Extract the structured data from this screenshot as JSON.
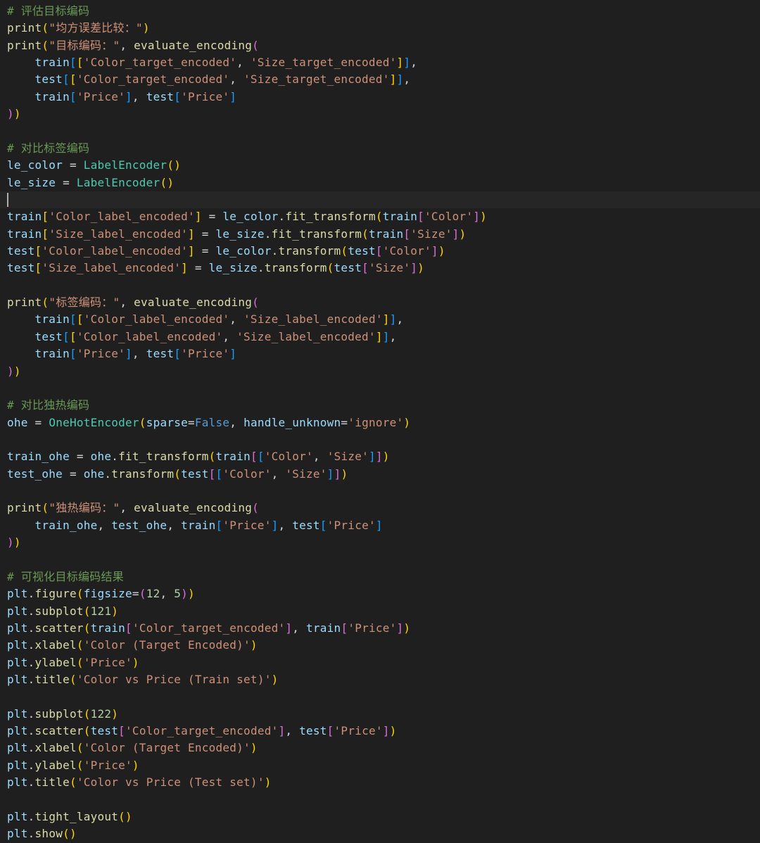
{
  "editor": {
    "lines": [
      [
        [
          "# 评估目标编码",
          "#6a9955"
        ]
      ],
      [
        [
          "print",
          "#dcdcaa"
        ],
        [
          "(",
          "#ffd700"
        ],
        [
          "\"均方误差比较：\"",
          "#ce9178"
        ],
        [
          ")",
          "#ffd700"
        ]
      ],
      [
        [
          "print",
          "#dcdcaa"
        ],
        [
          "(",
          "#ffd700"
        ],
        [
          "\"目标编码：\"",
          "#ce9178"
        ],
        [
          ", ",
          "#d4d4d4"
        ],
        [
          "evaluate_encoding",
          "#dcdcaa"
        ],
        [
          "(",
          "#da70d6"
        ]
      ],
      [
        [
          "    ",
          "#d4d4d4"
        ],
        [
          "train",
          "#9cdcfe"
        ],
        [
          "[",
          "#179fff"
        ],
        [
          "[",
          "#ffd700"
        ],
        [
          "'Color_target_encoded'",
          "#ce9178"
        ],
        [
          ", ",
          "#d4d4d4"
        ],
        [
          "'Size_target_encoded'",
          "#ce9178"
        ],
        [
          "]",
          "#ffd700"
        ],
        [
          "]",
          "#179fff"
        ],
        [
          ",",
          "#d4d4d4"
        ]
      ],
      [
        [
          "    ",
          "#d4d4d4"
        ],
        [
          "test",
          "#9cdcfe"
        ],
        [
          "[",
          "#179fff"
        ],
        [
          "[",
          "#ffd700"
        ],
        [
          "'Color_target_encoded'",
          "#ce9178"
        ],
        [
          ", ",
          "#d4d4d4"
        ],
        [
          "'Size_target_encoded'",
          "#ce9178"
        ],
        [
          "]",
          "#ffd700"
        ],
        [
          "]",
          "#179fff"
        ],
        [
          ",",
          "#d4d4d4"
        ]
      ],
      [
        [
          "    ",
          "#d4d4d4"
        ],
        [
          "train",
          "#9cdcfe"
        ],
        [
          "[",
          "#179fff"
        ],
        [
          "'Price'",
          "#ce9178"
        ],
        [
          "]",
          "#179fff"
        ],
        [
          ", ",
          "#d4d4d4"
        ],
        [
          "test",
          "#9cdcfe"
        ],
        [
          "[",
          "#179fff"
        ],
        [
          "'Price'",
          "#ce9178"
        ],
        [
          "]",
          "#179fff"
        ]
      ],
      [
        [
          ")",
          "#da70d6"
        ],
        [
          ")",
          "#ffd700"
        ]
      ],
      [],
      [
        [
          "# 对比标签编码",
          "#6a9955"
        ]
      ],
      [
        [
          "le_color",
          "#9cdcfe"
        ],
        [
          " = ",
          "#d4d4d4"
        ],
        [
          "LabelEncoder",
          "#4ec9b0"
        ],
        [
          "(",
          "#ffd700"
        ],
        [
          ")",
          "#ffd700"
        ]
      ],
      [
        [
          "le_size",
          "#9cdcfe"
        ],
        [
          " = ",
          "#d4d4d4"
        ],
        [
          "LabelEncoder",
          "#4ec9b0"
        ],
        [
          "(",
          "#ffd700"
        ],
        [
          ")",
          "#ffd700"
        ]
      ],
      [],
      [
        [
          "train",
          "#9cdcfe"
        ],
        [
          "[",
          "#ffd700"
        ],
        [
          "'Color_label_encoded'",
          "#ce9178"
        ],
        [
          "]",
          "#ffd700"
        ],
        [
          " = ",
          "#d4d4d4"
        ],
        [
          "le_color",
          "#9cdcfe"
        ],
        [
          ".",
          "#d4d4d4"
        ],
        [
          "fit_transform",
          "#dcdcaa"
        ],
        [
          "(",
          "#ffd700"
        ],
        [
          "train",
          "#9cdcfe"
        ],
        [
          "[",
          "#da70d6"
        ],
        [
          "'Color'",
          "#ce9178"
        ],
        [
          "]",
          "#da70d6"
        ],
        [
          ")",
          "#ffd700"
        ]
      ],
      [
        [
          "train",
          "#9cdcfe"
        ],
        [
          "[",
          "#ffd700"
        ],
        [
          "'Size_label_encoded'",
          "#ce9178"
        ],
        [
          "]",
          "#ffd700"
        ],
        [
          " = ",
          "#d4d4d4"
        ],
        [
          "le_size",
          "#9cdcfe"
        ],
        [
          ".",
          "#d4d4d4"
        ],
        [
          "fit_transform",
          "#dcdcaa"
        ],
        [
          "(",
          "#ffd700"
        ],
        [
          "train",
          "#9cdcfe"
        ],
        [
          "[",
          "#da70d6"
        ],
        [
          "'Size'",
          "#ce9178"
        ],
        [
          "]",
          "#da70d6"
        ],
        [
          ")",
          "#ffd700"
        ]
      ],
      [
        [
          "test",
          "#9cdcfe"
        ],
        [
          "[",
          "#ffd700"
        ],
        [
          "'Color_label_encoded'",
          "#ce9178"
        ],
        [
          "]",
          "#ffd700"
        ],
        [
          " = ",
          "#d4d4d4"
        ],
        [
          "le_color",
          "#9cdcfe"
        ],
        [
          ".",
          "#d4d4d4"
        ],
        [
          "transform",
          "#dcdcaa"
        ],
        [
          "(",
          "#ffd700"
        ],
        [
          "test",
          "#9cdcfe"
        ],
        [
          "[",
          "#da70d6"
        ],
        [
          "'Color'",
          "#ce9178"
        ],
        [
          "]",
          "#da70d6"
        ],
        [
          ")",
          "#ffd700"
        ]
      ],
      [
        [
          "test",
          "#9cdcfe"
        ],
        [
          "[",
          "#ffd700"
        ],
        [
          "'Size_label_encoded'",
          "#ce9178"
        ],
        [
          "]",
          "#ffd700"
        ],
        [
          " = ",
          "#d4d4d4"
        ],
        [
          "le_size",
          "#9cdcfe"
        ],
        [
          ".",
          "#d4d4d4"
        ],
        [
          "transform",
          "#dcdcaa"
        ],
        [
          "(",
          "#ffd700"
        ],
        [
          "test",
          "#9cdcfe"
        ],
        [
          "[",
          "#da70d6"
        ],
        [
          "'Size'",
          "#ce9178"
        ],
        [
          "]",
          "#da70d6"
        ],
        [
          ")",
          "#ffd700"
        ]
      ],
      [],
      [
        [
          "print",
          "#dcdcaa"
        ],
        [
          "(",
          "#ffd700"
        ],
        [
          "\"标签编码：\"",
          "#ce9178"
        ],
        [
          ", ",
          "#d4d4d4"
        ],
        [
          "evaluate_encoding",
          "#dcdcaa"
        ],
        [
          "(",
          "#da70d6"
        ]
      ],
      [
        [
          "    ",
          "#d4d4d4"
        ],
        [
          "train",
          "#9cdcfe"
        ],
        [
          "[",
          "#179fff"
        ],
        [
          "[",
          "#ffd700"
        ],
        [
          "'Color_label_encoded'",
          "#ce9178"
        ],
        [
          ", ",
          "#d4d4d4"
        ],
        [
          "'Size_label_encoded'",
          "#ce9178"
        ],
        [
          "]",
          "#ffd700"
        ],
        [
          "]",
          "#179fff"
        ],
        [
          ",",
          "#d4d4d4"
        ]
      ],
      [
        [
          "    ",
          "#d4d4d4"
        ],
        [
          "test",
          "#9cdcfe"
        ],
        [
          "[",
          "#179fff"
        ],
        [
          "[",
          "#ffd700"
        ],
        [
          "'Color_label_encoded'",
          "#ce9178"
        ],
        [
          ", ",
          "#d4d4d4"
        ],
        [
          "'Size_label_encoded'",
          "#ce9178"
        ],
        [
          "]",
          "#ffd700"
        ],
        [
          "]",
          "#179fff"
        ],
        [
          ",",
          "#d4d4d4"
        ]
      ],
      [
        [
          "    ",
          "#d4d4d4"
        ],
        [
          "train",
          "#9cdcfe"
        ],
        [
          "[",
          "#179fff"
        ],
        [
          "'Price'",
          "#ce9178"
        ],
        [
          "]",
          "#179fff"
        ],
        [
          ", ",
          "#d4d4d4"
        ],
        [
          "test",
          "#9cdcfe"
        ],
        [
          "[",
          "#179fff"
        ],
        [
          "'Price'",
          "#ce9178"
        ],
        [
          "]",
          "#179fff"
        ]
      ],
      [
        [
          ")",
          "#da70d6"
        ],
        [
          ")",
          "#ffd700"
        ]
      ],
      [],
      [
        [
          "# 对比独热编码",
          "#6a9955"
        ]
      ],
      [
        [
          "ohe",
          "#9cdcfe"
        ],
        [
          " = ",
          "#d4d4d4"
        ],
        [
          "OneHotEncoder",
          "#4ec9b0"
        ],
        [
          "(",
          "#ffd700"
        ],
        [
          "sparse",
          "#9cdcfe"
        ],
        [
          "=",
          "#d4d4d4"
        ],
        [
          "False",
          "#569cd6"
        ],
        [
          ", ",
          "#d4d4d4"
        ],
        [
          "handle_unknown",
          "#9cdcfe"
        ],
        [
          "=",
          "#d4d4d4"
        ],
        [
          "'ignore'",
          "#ce9178"
        ],
        [
          ")",
          "#ffd700"
        ]
      ],
      [],
      [
        [
          "train_ohe",
          "#9cdcfe"
        ],
        [
          " = ",
          "#d4d4d4"
        ],
        [
          "ohe",
          "#9cdcfe"
        ],
        [
          ".",
          "#d4d4d4"
        ],
        [
          "fit_transform",
          "#dcdcaa"
        ],
        [
          "(",
          "#ffd700"
        ],
        [
          "train",
          "#9cdcfe"
        ],
        [
          "[",
          "#da70d6"
        ],
        [
          "[",
          "#179fff"
        ],
        [
          "'Color'",
          "#ce9178"
        ],
        [
          ", ",
          "#d4d4d4"
        ],
        [
          "'Size'",
          "#ce9178"
        ],
        [
          "]",
          "#179fff"
        ],
        [
          "]",
          "#da70d6"
        ],
        [
          ")",
          "#ffd700"
        ]
      ],
      [
        [
          "test_ohe",
          "#9cdcfe"
        ],
        [
          " = ",
          "#d4d4d4"
        ],
        [
          "ohe",
          "#9cdcfe"
        ],
        [
          ".",
          "#d4d4d4"
        ],
        [
          "transform",
          "#dcdcaa"
        ],
        [
          "(",
          "#ffd700"
        ],
        [
          "test",
          "#9cdcfe"
        ],
        [
          "[",
          "#da70d6"
        ],
        [
          "[",
          "#179fff"
        ],
        [
          "'Color'",
          "#ce9178"
        ],
        [
          ", ",
          "#d4d4d4"
        ],
        [
          "'Size'",
          "#ce9178"
        ],
        [
          "]",
          "#179fff"
        ],
        [
          "]",
          "#da70d6"
        ],
        [
          ")",
          "#ffd700"
        ]
      ],
      [],
      [
        [
          "print",
          "#dcdcaa"
        ],
        [
          "(",
          "#ffd700"
        ],
        [
          "\"独热编码：\"",
          "#ce9178"
        ],
        [
          ", ",
          "#d4d4d4"
        ],
        [
          "evaluate_encoding",
          "#dcdcaa"
        ],
        [
          "(",
          "#da70d6"
        ]
      ],
      [
        [
          "    ",
          "#d4d4d4"
        ],
        [
          "train_ohe",
          "#9cdcfe"
        ],
        [
          ", ",
          "#d4d4d4"
        ],
        [
          "test_ohe",
          "#9cdcfe"
        ],
        [
          ", ",
          "#d4d4d4"
        ],
        [
          "train",
          "#9cdcfe"
        ],
        [
          "[",
          "#179fff"
        ],
        [
          "'Price'",
          "#ce9178"
        ],
        [
          "]",
          "#179fff"
        ],
        [
          ", ",
          "#d4d4d4"
        ],
        [
          "test",
          "#9cdcfe"
        ],
        [
          "[",
          "#179fff"
        ],
        [
          "'Price'",
          "#ce9178"
        ],
        [
          "]",
          "#179fff"
        ]
      ],
      [
        [
          ")",
          "#da70d6"
        ],
        [
          ")",
          "#ffd700"
        ]
      ],
      [],
      [
        [
          "# 可视化目标编码结果",
          "#6a9955"
        ]
      ],
      [
        [
          "plt",
          "#9cdcfe"
        ],
        [
          ".",
          "#d4d4d4"
        ],
        [
          "figure",
          "#dcdcaa"
        ],
        [
          "(",
          "#ffd700"
        ],
        [
          "figsize",
          "#9cdcfe"
        ],
        [
          "=",
          "#d4d4d4"
        ],
        [
          "(",
          "#da70d6"
        ],
        [
          "12",
          "#b5cea8"
        ],
        [
          ", ",
          "#d4d4d4"
        ],
        [
          "5",
          "#b5cea8"
        ],
        [
          ")",
          "#da70d6"
        ],
        [
          ")",
          "#ffd700"
        ]
      ],
      [
        [
          "plt",
          "#9cdcfe"
        ],
        [
          ".",
          "#d4d4d4"
        ],
        [
          "subplot",
          "#dcdcaa"
        ],
        [
          "(",
          "#ffd700"
        ],
        [
          "121",
          "#b5cea8"
        ],
        [
          ")",
          "#ffd700"
        ]
      ],
      [
        [
          "plt",
          "#9cdcfe"
        ],
        [
          ".",
          "#d4d4d4"
        ],
        [
          "scatter",
          "#dcdcaa"
        ],
        [
          "(",
          "#ffd700"
        ],
        [
          "train",
          "#9cdcfe"
        ],
        [
          "[",
          "#da70d6"
        ],
        [
          "'Color_target_encoded'",
          "#ce9178"
        ],
        [
          "]",
          "#da70d6"
        ],
        [
          ", ",
          "#d4d4d4"
        ],
        [
          "train",
          "#9cdcfe"
        ],
        [
          "[",
          "#da70d6"
        ],
        [
          "'Price'",
          "#ce9178"
        ],
        [
          "]",
          "#da70d6"
        ],
        [
          ")",
          "#ffd700"
        ]
      ],
      [
        [
          "plt",
          "#9cdcfe"
        ],
        [
          ".",
          "#d4d4d4"
        ],
        [
          "xlabel",
          "#dcdcaa"
        ],
        [
          "(",
          "#ffd700"
        ],
        [
          "'Color (Target Encoded)'",
          "#ce9178"
        ],
        [
          ")",
          "#ffd700"
        ]
      ],
      [
        [
          "plt",
          "#9cdcfe"
        ],
        [
          ".",
          "#d4d4d4"
        ],
        [
          "ylabel",
          "#dcdcaa"
        ],
        [
          "(",
          "#ffd700"
        ],
        [
          "'Price'",
          "#ce9178"
        ],
        [
          ")",
          "#ffd700"
        ]
      ],
      [
        [
          "plt",
          "#9cdcfe"
        ],
        [
          ".",
          "#d4d4d4"
        ],
        [
          "title",
          "#dcdcaa"
        ],
        [
          "(",
          "#ffd700"
        ],
        [
          "'Color vs Price (Train set)'",
          "#ce9178"
        ],
        [
          ")",
          "#ffd700"
        ]
      ],
      [],
      [
        [
          "plt",
          "#9cdcfe"
        ],
        [
          ".",
          "#d4d4d4"
        ],
        [
          "subplot",
          "#dcdcaa"
        ],
        [
          "(",
          "#ffd700"
        ],
        [
          "122",
          "#b5cea8"
        ],
        [
          ")",
          "#ffd700"
        ]
      ],
      [
        [
          "plt",
          "#9cdcfe"
        ],
        [
          ".",
          "#d4d4d4"
        ],
        [
          "scatter",
          "#dcdcaa"
        ],
        [
          "(",
          "#ffd700"
        ],
        [
          "test",
          "#9cdcfe"
        ],
        [
          "[",
          "#da70d6"
        ],
        [
          "'Color_target_encoded'",
          "#ce9178"
        ],
        [
          "]",
          "#da70d6"
        ],
        [
          ", ",
          "#d4d4d4"
        ],
        [
          "test",
          "#9cdcfe"
        ],
        [
          "[",
          "#da70d6"
        ],
        [
          "'Price'",
          "#ce9178"
        ],
        [
          "]",
          "#da70d6"
        ],
        [
          ")",
          "#ffd700"
        ]
      ],
      [
        [
          "plt",
          "#9cdcfe"
        ],
        [
          ".",
          "#d4d4d4"
        ],
        [
          "xlabel",
          "#dcdcaa"
        ],
        [
          "(",
          "#ffd700"
        ],
        [
          "'Color (Target Encoded)'",
          "#ce9178"
        ],
        [
          ")",
          "#ffd700"
        ]
      ],
      [
        [
          "plt",
          "#9cdcfe"
        ],
        [
          ".",
          "#d4d4d4"
        ],
        [
          "ylabel",
          "#dcdcaa"
        ],
        [
          "(",
          "#ffd700"
        ],
        [
          "'Price'",
          "#ce9178"
        ],
        [
          ")",
          "#ffd700"
        ]
      ],
      [
        [
          "plt",
          "#9cdcfe"
        ],
        [
          ".",
          "#d4d4d4"
        ],
        [
          "title",
          "#dcdcaa"
        ],
        [
          "(",
          "#ffd700"
        ],
        [
          "'Color vs Price (Test set)'",
          "#ce9178"
        ],
        [
          ")",
          "#ffd700"
        ]
      ],
      [],
      [
        [
          "plt",
          "#9cdcfe"
        ],
        [
          ".",
          "#d4d4d4"
        ],
        [
          "tight_layout",
          "#dcdcaa"
        ],
        [
          "(",
          "#ffd700"
        ],
        [
          ")",
          "#ffd700"
        ]
      ],
      [
        [
          "plt",
          "#9cdcfe"
        ],
        [
          ".",
          "#d4d4d4"
        ],
        [
          "show",
          "#dcdcaa"
        ],
        [
          "(",
          "#ffd700"
        ],
        [
          ")",
          "#ffd700"
        ]
      ]
    ],
    "cursor_line": 11,
    "colors": {
      "background": "#1f1f1f",
      "current_line": "#262626",
      "caret": "#aeafad",
      "comment": "#6a9955",
      "function": "#dcdcaa",
      "variable": "#9cdcfe",
      "string": "#ce9178",
      "class": "#4ec9b0",
      "number": "#b5cea8",
      "keyword_constant": "#569cd6",
      "bracket_gold": "#ffd700",
      "bracket_orchid": "#da70d6",
      "bracket_blue": "#179fff"
    }
  }
}
